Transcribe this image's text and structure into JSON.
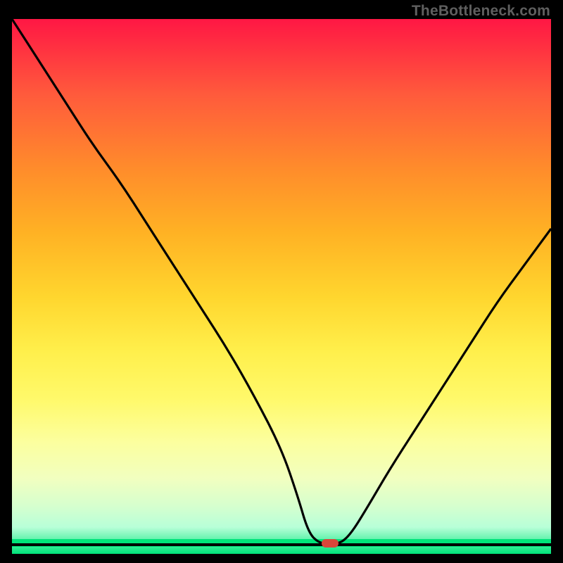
{
  "watermark": "TheBottleneck.com",
  "colors": {
    "gradient_red": "#ff1744",
    "gradient_orange1": "#ff5a3c",
    "gradient_orange2": "#ff8c2b",
    "gradient_yellow1": "#ffb224",
    "gradient_yellow2": "#ffd62e",
    "gradient_yellow3": "#ffef4b",
    "gradient_yellow4": "#fff96a",
    "gradient_paleyellow": "#fcff9e",
    "gradient_pale": "#f1ffc0",
    "gradient_paler": "#d6ffce",
    "gradient_palest": "#b8ffd8",
    "gradient_green": "#00e47a",
    "curve_color": "#000000",
    "marker_color": "#d9463a",
    "axis_color": "#000000",
    "background": "#000000"
  },
  "chart_data": {
    "type": "line",
    "title": "",
    "xlabel": "",
    "ylabel": "",
    "xlim": [
      0,
      100
    ],
    "ylim": [
      0,
      100
    ],
    "x": [
      0,
      5,
      10,
      15,
      20,
      25,
      30,
      35,
      40,
      45,
      50,
      53,
      55,
      57,
      59,
      61,
      63,
      66,
      70,
      75,
      80,
      85,
      90,
      95,
      100
    ],
    "values": [
      100,
      92,
      84,
      76,
      69,
      61,
      53,
      45,
      37,
      28,
      18,
      9,
      2,
      0,
      0,
      0,
      2,
      7,
      14,
      22,
      30,
      38,
      46,
      53,
      60
    ],
    "marker": {
      "x": 59,
      "y": 0,
      "w": 3.2,
      "h": 1.6
    },
    "notes": "x and y are percentages of the plot area; curve is a bottleneck V-shape reaching 0 near x≈57–61."
  }
}
